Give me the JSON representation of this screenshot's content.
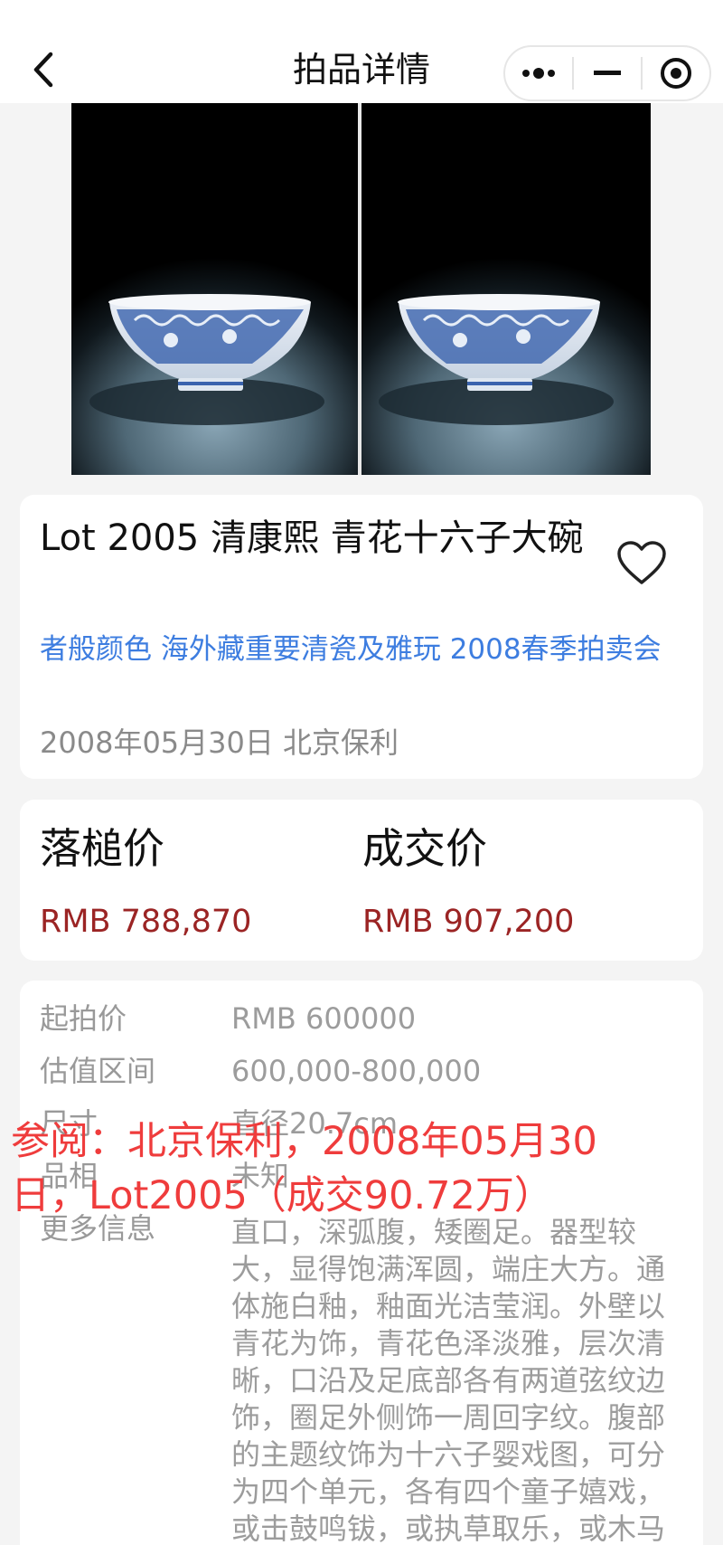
{
  "nav": {
    "title": "拍品详情",
    "back_icon": "chevron-left-icon",
    "more_icon": "more-dots-icon",
    "minimize_icon": "minus-icon",
    "close_icon": "target-close-icon"
  },
  "item": {
    "title": "Lot 2005 清康熙 青花十六子大碗",
    "sale_link": "者般颜色 海外藏重要清瓷及雅玩 2008春季拍卖会",
    "meta": "2008年05月30日 北京保利",
    "favorite_icon": "heart-outline-icon"
  },
  "prices": {
    "hammer_label": "落槌价",
    "hammer_value": "RMB 788,870",
    "final_label": "成交价",
    "final_value": "RMB 907,200",
    "accent_color": "#9b2424"
  },
  "info": {
    "rows": [
      {
        "label": "起拍价",
        "value": "RMB 600000"
      },
      {
        "label": "估值区间",
        "value": "600,000-800,000"
      },
      {
        "label": "尺寸",
        "value": "直径20.7cm"
      },
      {
        "label": "品相",
        "value": "未知"
      }
    ],
    "more_label": "更多信息",
    "more_text": "直口，深弧腹，矮圈足。器型较大，显得饱满浑圆，端庄大方。通体施白釉，釉面光洁莹润。外壁以青花为饰，青花色泽淡雅，层次清晰，口沿及足底部各有两道弦纹边饰，圈足外侧饰一周回字纹。腹部的主题纹饰为十六子婴戏图，可分为四个单元，各有四个童子嬉戏，或击鼓鸣钹，或执草取乐，或木马"
  },
  "overlay": {
    "text": "参阅：北京保利，2008年05月30日，Lot2005（成交90.72万）",
    "color": "#ef3c3c"
  }
}
